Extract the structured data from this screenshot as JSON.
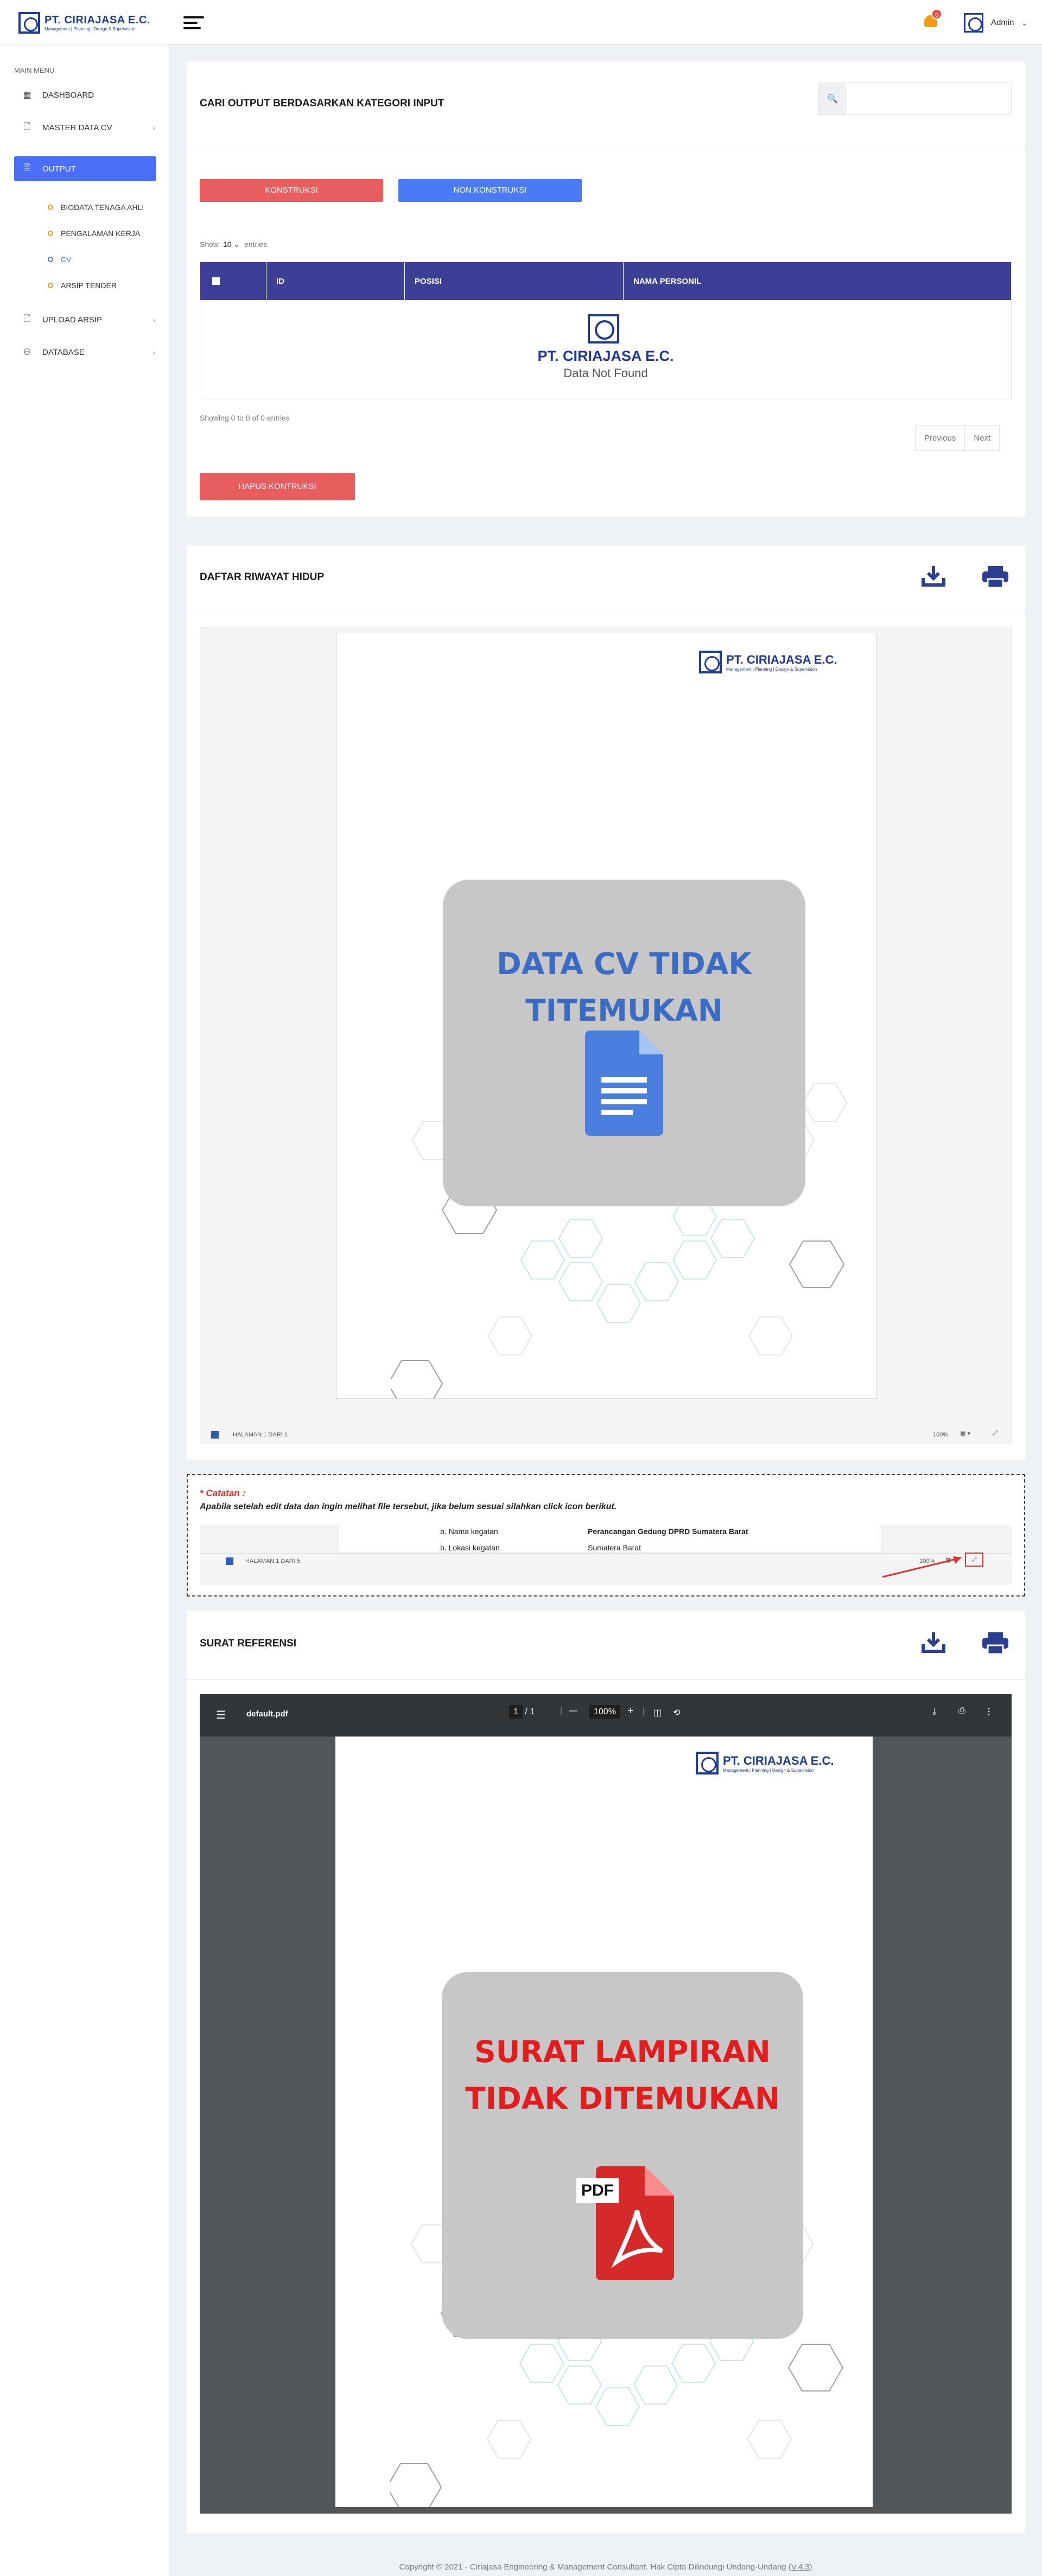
{
  "brand": {
    "name": "PT. CIRIAJASA E.C.",
    "tagline": "Management | Planning | Design & Supervision"
  },
  "topbar": {
    "notification_count": "0",
    "user_name": "Admin"
  },
  "sidebar": {
    "menu_title": "MAIN MENU",
    "items": [
      {
        "label": "DASHBOARD",
        "icon": "grid-icon"
      },
      {
        "label": "MASTER DATA CV",
        "icon": "file-icon"
      },
      {
        "label": "OUTPUT",
        "icon": "document-icon"
      },
      {
        "label": "UPLOAD ARSIP",
        "icon": "upload-file-icon"
      },
      {
        "label": "DATABASE",
        "icon": "database-icon"
      }
    ],
    "output_subitems": [
      "BIODATA TENAGA AHLI",
      "PENGALAMAN KERJA",
      "CV",
      "ARSIP TENDER"
    ],
    "active_subitem": "CV"
  },
  "search_card": {
    "title": "CARI OUTPUT BERDASARKAN KATEGORI INPUT",
    "search_placeholder": "",
    "btn_konstruksi": "KONSTRUKSI",
    "btn_non_konstruksi": "NON KONSTRUKSI",
    "show_label": "Show",
    "show_value": "10",
    "entries_label": "entries",
    "columns": [
      "ID",
      "POSISI",
      "NAMA PERSONIL"
    ],
    "empty_brand": "PT. CIRIAJASA E.C.",
    "empty_text": "Data Not Found",
    "showing": "Showing 0 to 0 of 0 entries",
    "pager_prev": "Previous",
    "pager_next": "Next",
    "btn_delete": "HAPUS KONTRUKSI"
  },
  "cv_card": {
    "title": "DAFTAR RIWAYAT HIDUP",
    "notice": "DATA CV TIDAK TITEMUKAN",
    "footer_page": "HALAMAN 1 DARI 1",
    "footer_zoom": "100%"
  },
  "note": {
    "title": "* Catatan :",
    "text": "Apabila setelah edit data dan ingin melihat file tersebut, jika belum sesuai silahkan click icon berikut.",
    "row1_label": "a. Nama kegatan",
    "row1_value": "Perancangan Gedung DPRD Sumatera Barat",
    "row2_label": "b. Lokasi kegatan",
    "row2_value": "Sumatera Barat",
    "footer_page": "HALAMAN 1 DARI 5",
    "footer_zoom": "100%"
  },
  "ref_card": {
    "title": "SURAT REFERENSI",
    "pdf_filename": "default.pdf",
    "pdf_page": "1",
    "pdf_total": "1",
    "pdf_zoom": "100%",
    "notice": "SURAT LAMPIRAN TIDAK DITEMUKAN",
    "pdf_badge": "PDF"
  },
  "footer": {
    "prefix": "Copyright © 2021 - Ciriajasa Engineering & Management Consultant. Hak Cipta Dilindungi Undang-Undang (",
    "version": "V.4.3",
    "suffix": ")"
  }
}
